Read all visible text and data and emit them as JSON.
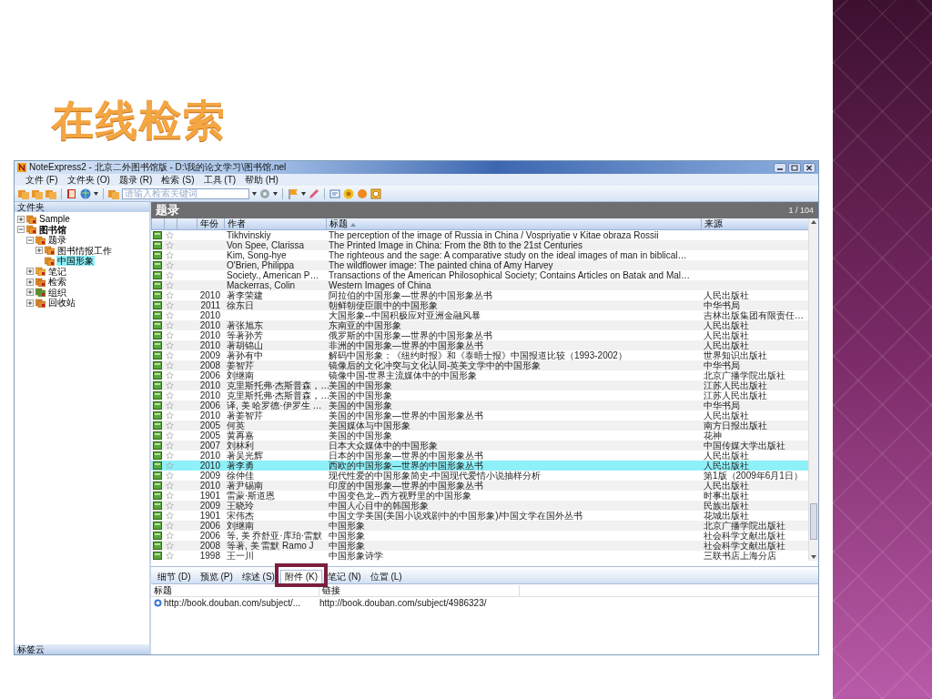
{
  "slide_title": "在线检索",
  "window": {
    "title": "NoteExpress2 - 北京二外图书馆版 - D:\\我的论文学习\\图书馆.nel",
    "menu": [
      "文件 (F)",
      "文件夹 (O)",
      "题录 (R)",
      "检索 (S)",
      "工具 (T)",
      "帮助 (H)"
    ],
    "search": {
      "placeholder": "请输入检索关键词"
    }
  },
  "folders": {
    "header": "文件夹",
    "footer": "标签云",
    "tree": [
      {
        "label": "Sample",
        "kind": "folder",
        "expanded": false,
        "selected": false
      },
      {
        "label": "图书馆",
        "kind": "library",
        "expanded": true,
        "selected": false,
        "children": [
          {
            "label": "题录",
            "kind": "folder",
            "expanded": true,
            "selected": false,
            "children": [
              {
                "label": "图书情报工作",
                "kind": "folder",
                "expanded": false,
                "selected": false
              },
              {
                "label": "中国形象",
                "kind": "folder",
                "selected": true
              }
            ]
          },
          {
            "label": "笔记",
            "kind": "notes",
            "expanded": false,
            "selected": false
          },
          {
            "label": "检索",
            "kind": "search",
            "expanded": false,
            "selected": false
          },
          {
            "label": "组织",
            "kind": "group",
            "expanded": false,
            "selected": false
          },
          {
            "label": "回收站",
            "kind": "trash",
            "expanded": false,
            "selected": false
          }
        ]
      }
    ]
  },
  "records": {
    "header": "题录",
    "count": "1 / 104",
    "columns": [
      "年份",
      "作者",
      "标题",
      "来源"
    ],
    "rows": [
      {
        "author": "Tikhvinskiy",
        "title": "The perception of the image of Russia in China / Vospriyatie v Kitae obraza Rossii",
        "selected": false
      },
      {
        "author": "Von Spee, Clarissa",
        "title": "The Printed Image in China: From the 8th to the 21st Centuries",
        "selected": false
      },
      {
        "author": "Kim, Song-hye",
        "title": "The righteous and the sage: A comparative study on the ideal images of man in biblical…",
        "selected": false
      },
      {
        "author": "O'Brien, Philippa",
        "title": "The wildflower image: The painted china of Amy Harvey",
        "selected": false
      },
      {
        "author": "Society., American P…",
        "title": "Transactions of the American Philosophical Society; Contains Articles on Batak and Mal…",
        "selected": false
      },
      {
        "author": "Mackerras, Colin",
        "title": "Western Images of China",
        "selected": false
      },
      {
        "year": "2010",
        "author": "著李荣建",
        "title": "阿拉伯的中国形象—世界的中国形象丛书",
        "source": "人民出版社",
        "selected": false
      },
      {
        "year": "2011",
        "author": "徐东日",
        "title": "朝鲜朝使臣眼中的中国形象",
        "source": "中华书局",
        "selected": false
      },
      {
        "year": "2010",
        "title": "大国形象--中国积极应对亚洲金融风暴",
        "source": "吉林出版集团有限责任…",
        "selected": false
      },
      {
        "year": "2010",
        "author": "著张旭东",
        "title": "东南亚的中国形象",
        "source": "人民出版社",
        "selected": false
      },
      {
        "year": "2010",
        "author": "等著孙芳",
        "title": "俄罗斯的中国形象—世界的中国形象丛书",
        "source": "人民出版社",
        "selected": false
      },
      {
        "year": "2010",
        "author": "著胡锦山",
        "title": "非洲的中国形象—世界的中国形象丛书",
        "source": "人民出版社",
        "selected": false
      },
      {
        "year": "2009",
        "author": "著孙有中",
        "title": "解码中国形象：《纽约时报》和《泰晤士报》中国报道比较（1993-2002）",
        "source": "世界知识出版社",
        "selected": false
      },
      {
        "year": "2008",
        "author": "姜智芹",
        "title": "镜像后的文化冲突与文化认同-英美文学中的中国形象",
        "source": "中华书局",
        "selected": false
      },
      {
        "year": "2006",
        "author": "刘继南",
        "title": "镜像中国-世界主流媒体中的中国形象",
        "source": "北京广播学院出版社",
        "selected": false
      },
      {
        "year": "2010",
        "author": "克里斯托弗·杰斯普森，…",
        "title": "美国的中国形象",
        "source": "江苏人民出版社",
        "selected": false
      },
      {
        "year": "2010",
        "author": "克里斯托弗·杰斯普森，…",
        "title": "美国的中国形象",
        "source": "江苏人民出版社",
        "selected": false
      },
      {
        "year": "2006",
        "author": "译, 美 哈罗德·伊罗生 …",
        "title": "美国的中国形象",
        "source": "中华书局",
        "selected": false
      },
      {
        "year": "2010",
        "author": "著姜智芹",
        "title": "美国的中国形象—世界的中国形象丛书",
        "source": "人民出版社",
        "selected": false
      },
      {
        "year": "2005",
        "author": "何英",
        "title": "美国媒体与中国形象",
        "source": "南方日报出版社",
        "selected": false
      },
      {
        "year": "2005",
        "author": "黄再嘉",
        "title": "美国的中国形象",
        "source": "花神",
        "selected": false
      },
      {
        "year": "2007",
        "author": "刘林利",
        "title": "日本大众媒体中的中国形象",
        "source": "中国传媒大学出版社",
        "selected": false
      },
      {
        "year": "2010",
        "author": "著吴光辉",
        "title": "日本的中国形象—世界的中国形象丛书",
        "source": "人民出版社",
        "selected": false
      },
      {
        "year": "2010",
        "author": "著李勇",
        "title": "西欧的中国形象—世界的中国形象丛书",
        "source": "人民出版社",
        "selected": true
      },
      {
        "year": "2009",
        "author": "徐仲佳",
        "title": "现代性爱的中国形象简史-中国现代爱情小说抽样分析",
        "source": "第1版（2009年6月1日）",
        "selected": false
      },
      {
        "year": "2010",
        "author": "著尹锡南",
        "title": "印度的中国形象—世界的中国形象丛书",
        "source": "人民出版社",
        "selected": false
      },
      {
        "year": "1901",
        "author": "雷蒙·斯道恩",
        "title": "中国变色龙--西方视野里的中国形象",
        "source": "时事出版社",
        "selected": false
      },
      {
        "year": "2009",
        "author": "王晓玲",
        "title": "中国人心目中的韩国形象",
        "source": "民族出版社",
        "selected": false
      },
      {
        "year": "1901",
        "author": "宋伟杰",
        "title": "中国文学美国(美国小说戏剧中的中国形象)/中国文学在国外丛书",
        "source": "花城出版社",
        "selected": false
      },
      {
        "year": "2006",
        "author": "刘继南",
        "title": "中国形象",
        "source": "北京广播学院出版社",
        "selected": false
      },
      {
        "year": "2006",
        "author": "等, 美 乔舒亚·库珀·雷默",
        "title": "中国形象",
        "source": "社会科学文献出版社",
        "selected": false
      },
      {
        "year": "2008",
        "author": "等著, 美 雷默 Ramo J",
        "title": "中国形象",
        "source": "社会科学文献出版社",
        "selected": false
      },
      {
        "year": "1998",
        "author": "王一川",
        "title": "中国形象诗学",
        "source": "三联书店上海分店",
        "selected": false
      }
    ]
  },
  "detail_tabs": [
    {
      "label": "细节 (D)",
      "selected": false,
      "highlighted": false
    },
    {
      "label": "预览 (P)",
      "selected": false,
      "highlighted": false
    },
    {
      "label": "综述 (S)",
      "selected": false,
      "highlighted": false
    },
    {
      "label": "附件 (K)",
      "selected": true,
      "highlighted": true
    },
    {
      "label": "笔记 (N)",
      "selected": false,
      "highlighted": false
    },
    {
      "label": "位置 (L)",
      "selected": false,
      "highlighted": false
    }
  ],
  "attachments": {
    "columns": [
      "标题",
      "链接"
    ],
    "rows": [
      {
        "title": "http://book.douban.com/subject/...",
        "link": "http://book.douban.com/subject/4986323/"
      }
    ]
  }
}
